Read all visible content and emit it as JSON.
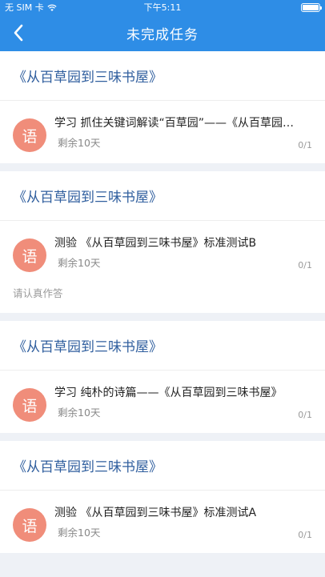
{
  "status": {
    "carrier": "无 SIM 卡",
    "time": "下午5:11"
  },
  "nav": {
    "title": "未完成任务"
  },
  "cards": [
    {
      "book": "《从百草园到三味书屋》",
      "avatar_text": "语",
      "task_title": "学习  抓住关键词解读“百草园”——《从百草园到三味书屋》",
      "remaining": "剩余10天",
      "progress": "0/1",
      "note": ""
    },
    {
      "book": "《从百草园到三味书屋》",
      "avatar_text": "语",
      "task_title": "测验  《从百草园到三味书屋》标准测试B",
      "remaining": "剩余10天",
      "progress": "0/1",
      "note": "请认真作答"
    },
    {
      "book": "《从百草园到三味书屋》",
      "avatar_text": "语",
      "task_title": "学习  纯朴的诗篇——《从百草园到三味书屋》",
      "remaining": "剩余10天",
      "progress": "0/1",
      "note": ""
    },
    {
      "book": "《从百草园到三味书屋》",
      "avatar_text": "语",
      "task_title": "测验  《从百草园到三味书屋》标准测试A",
      "remaining": "剩余10天",
      "progress": "0/1",
      "note": ""
    }
  ],
  "colors": {
    "nav_bg": "#2e8de6",
    "book_title": "#2f5e9e",
    "avatar_bg": "#f08d7a",
    "page_bg": "#eef1f6"
  },
  "icons": {
    "back": "chevron-left-icon",
    "wifi": "wifi-icon",
    "battery": "battery-icon"
  }
}
